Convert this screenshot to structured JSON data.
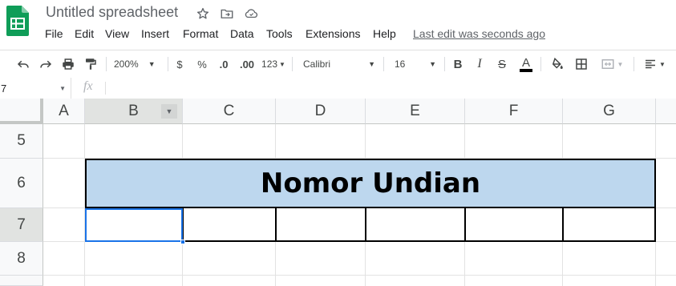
{
  "app": {
    "title": "Untitled spreadsheet",
    "last_edit": "Last edit was seconds ago"
  },
  "menu": [
    "File",
    "Edit",
    "View",
    "Insert",
    "Format",
    "Data",
    "Tools",
    "Extensions",
    "Help"
  ],
  "toolbar": {
    "zoom": "200%",
    "currency": "$",
    "percent": "%",
    "decrease_decimal": ".0",
    "increase_decimal": ".00",
    "number_format": "123",
    "font": "Calibri",
    "font_size": "16",
    "bold": "B",
    "italic": "I",
    "strike": "S",
    "text_color": "A"
  },
  "formula_bar": {
    "name_box": "7",
    "fx": "fx",
    "value": ""
  },
  "columns": [
    "A",
    "B",
    "C",
    "D",
    "E",
    "F",
    "G"
  ],
  "rows": [
    "5",
    "6",
    "7",
    "8"
  ],
  "cells": {
    "merged_title": "Nomor Undian"
  },
  "colors": {
    "header_fill": "#bdd7ee",
    "selection": "#1a73e8",
    "sheets_green": "#0f9d58"
  },
  "icons": [
    "sheets-logo-icon",
    "star-icon",
    "move-folder-icon",
    "cloud-status-icon",
    "undo-icon",
    "redo-icon",
    "print-icon",
    "paint-format-icon",
    "fill-color-icon",
    "borders-icon",
    "merge-cells-icon",
    "align-icon"
  ]
}
